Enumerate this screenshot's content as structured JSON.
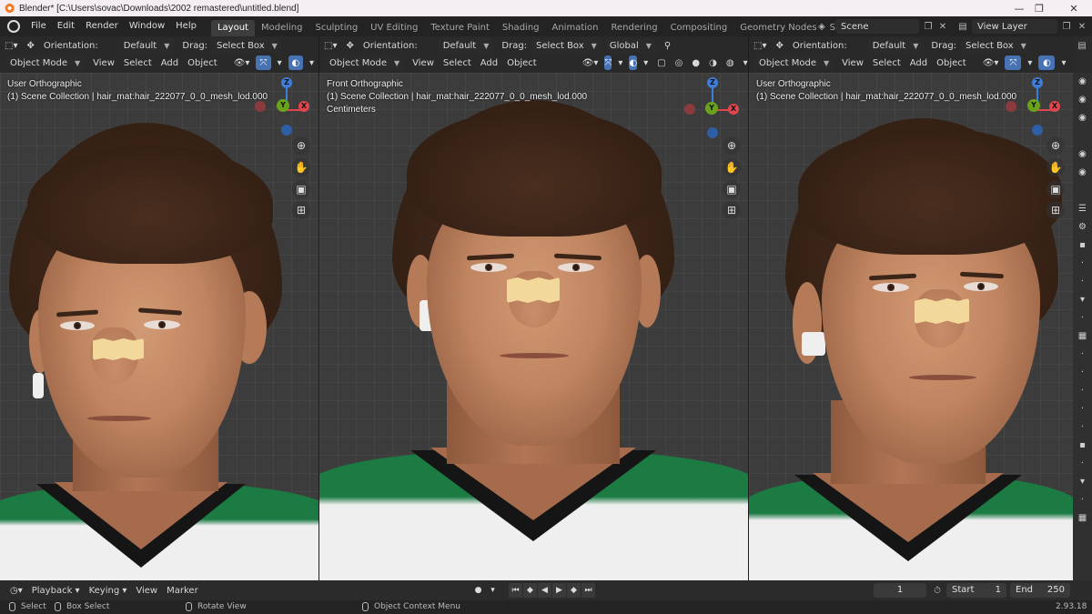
{
  "window": {
    "title": "Blender* [C:\\Users\\sovac\\Downloads\\2002 remastered\\untitled.blend]",
    "minimize": "—",
    "maximize": "❐",
    "close": "✕"
  },
  "menu": [
    "File",
    "Edit",
    "Render",
    "Window",
    "Help"
  ],
  "workspaces": [
    "Layout",
    "Modeling",
    "Sculpting",
    "UV Editing",
    "Texture Paint",
    "Shading",
    "Animation",
    "Rendering",
    "Compositing",
    "Geometry Nodes",
    "Scripting"
  ],
  "active_workspace": "Layout",
  "scene": {
    "name": "Scene",
    "view_layer": "View Layer"
  },
  "viewports": [
    {
      "orientation_label": "Orientation:",
      "orientation_value": "Default",
      "drag_label": "Drag:",
      "drag_value": "Select Box",
      "mode": "Object Mode",
      "menus": [
        "View",
        "Select",
        "Add",
        "Object"
      ],
      "view_name": "User Orthographic",
      "collection": "(1) Scene Collection | hair_mat:hair_222077_0_0_mesh_lod.000",
      "units": ""
    },
    {
      "orientation_label": "Orientation:",
      "orientation_value": "Default",
      "drag_label": "Drag:",
      "drag_value": "Select Box",
      "transform_orientation": "Global",
      "mode": "Object Mode",
      "menus": [
        "View",
        "Select",
        "Add",
        "Object"
      ],
      "view_name": "Front Orthographic",
      "collection": "(1) Scene Collection | hair_mat:hair_222077_0_0_mesh_lod.000",
      "units": "Centimeters"
    },
    {
      "orientation_label": "Orientation:",
      "orientation_value": "Default",
      "drag_label": "Drag:",
      "drag_value": "Select Box",
      "mode": "Object Mode",
      "menus": [
        "View",
        "Select",
        "Add",
        "Object"
      ],
      "view_name": "User Orthographic",
      "collection": "(1) Scene Collection | hair_mat:hair_222077_0_0_mesh_lod.000",
      "units": ""
    }
  ],
  "gizmo_axes": {
    "x": "X",
    "y": "Y",
    "z": "Z"
  },
  "gizmo_colors": {
    "x": "#e0464e",
    "y": "#6aa21c",
    "z": "#3c7ed9"
  },
  "timeline": {
    "menus": [
      "Playback",
      "Keying",
      "View",
      "Marker"
    ],
    "current_frame": "1",
    "start_label": "Start",
    "start_value": "1",
    "end_label": "End",
    "end_value": "250"
  },
  "status": {
    "select": "Select",
    "box_select": "Box Select",
    "rotate_view": "Rotate View",
    "context_menu": "Object Context Menu",
    "version": "2.93.18"
  },
  "icons": {
    "move": "move-icon",
    "cursor": "select-cursor-icon",
    "zoom": "zoom-icon",
    "pan": "hand-icon",
    "camera": "camera-icon",
    "grid": "grid-icon"
  }
}
